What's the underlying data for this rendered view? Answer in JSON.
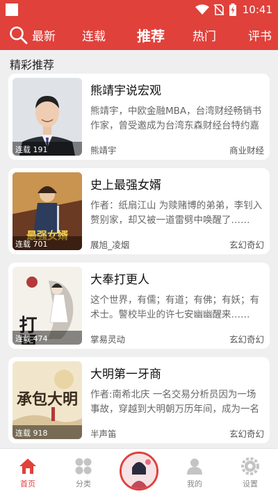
{
  "status_bar": {
    "time": "10:41"
  },
  "tabs": [
    {
      "label": "最新"
    },
    {
      "label": "连载"
    },
    {
      "label": "推荐",
      "active": true
    },
    {
      "label": "热门"
    },
    {
      "label": "评书"
    }
  ],
  "section_title": "精彩推荐",
  "books": [
    {
      "title": "熊靖宇说宏观",
      "description": "熊靖宇，中欧金融MBA，台湾财经畅销书作家，曾受邀成为台湾东森财经台特约嘉宾……",
      "author": "熊靖宇",
      "category": "商业财经",
      "badge": "连载 191"
    },
    {
      "title": "史上最强女婿",
      "description": "作者：纸扇江山 为赎赌博的弟弟，李钊入赘别家，却又被一道雷劈中唤醒了……",
      "author": "展旭_凌烟",
      "category": "玄幻奇幻",
      "badge": "连载 701",
      "cover_text": "最强女婿"
    },
    {
      "title": "大奉打更人",
      "description": "这个世界，有儒；有道；有佛；有妖；有术士。警校毕业的许七安幽幽醒来……",
      "author": "掌易灵动",
      "category": "玄幻奇幻",
      "badge": "连载 474",
      "cover_text": "打更人"
    },
    {
      "title": "大明第一牙商",
      "description": "作者:南希北庆 一名交易分析员因为一场事故，穿越到大明朝万历年间，成为一名牙商……",
      "author": "半声笛",
      "category": "玄幻奇幻",
      "badge": "连载 918",
      "cover_text": "承包大明"
    }
  ],
  "bottom_nav": [
    {
      "label": "首页",
      "icon": "home-icon",
      "active": true
    },
    {
      "label": "分类",
      "icon": "category-grid-icon"
    },
    {
      "label": "",
      "icon": "player-avatar"
    },
    {
      "label": "我的",
      "icon": "user-icon"
    },
    {
      "label": "设置",
      "icon": "settings-gear-icon"
    }
  ],
  "colors": {
    "primary": "#e0413b",
    "background": "#efefef"
  }
}
